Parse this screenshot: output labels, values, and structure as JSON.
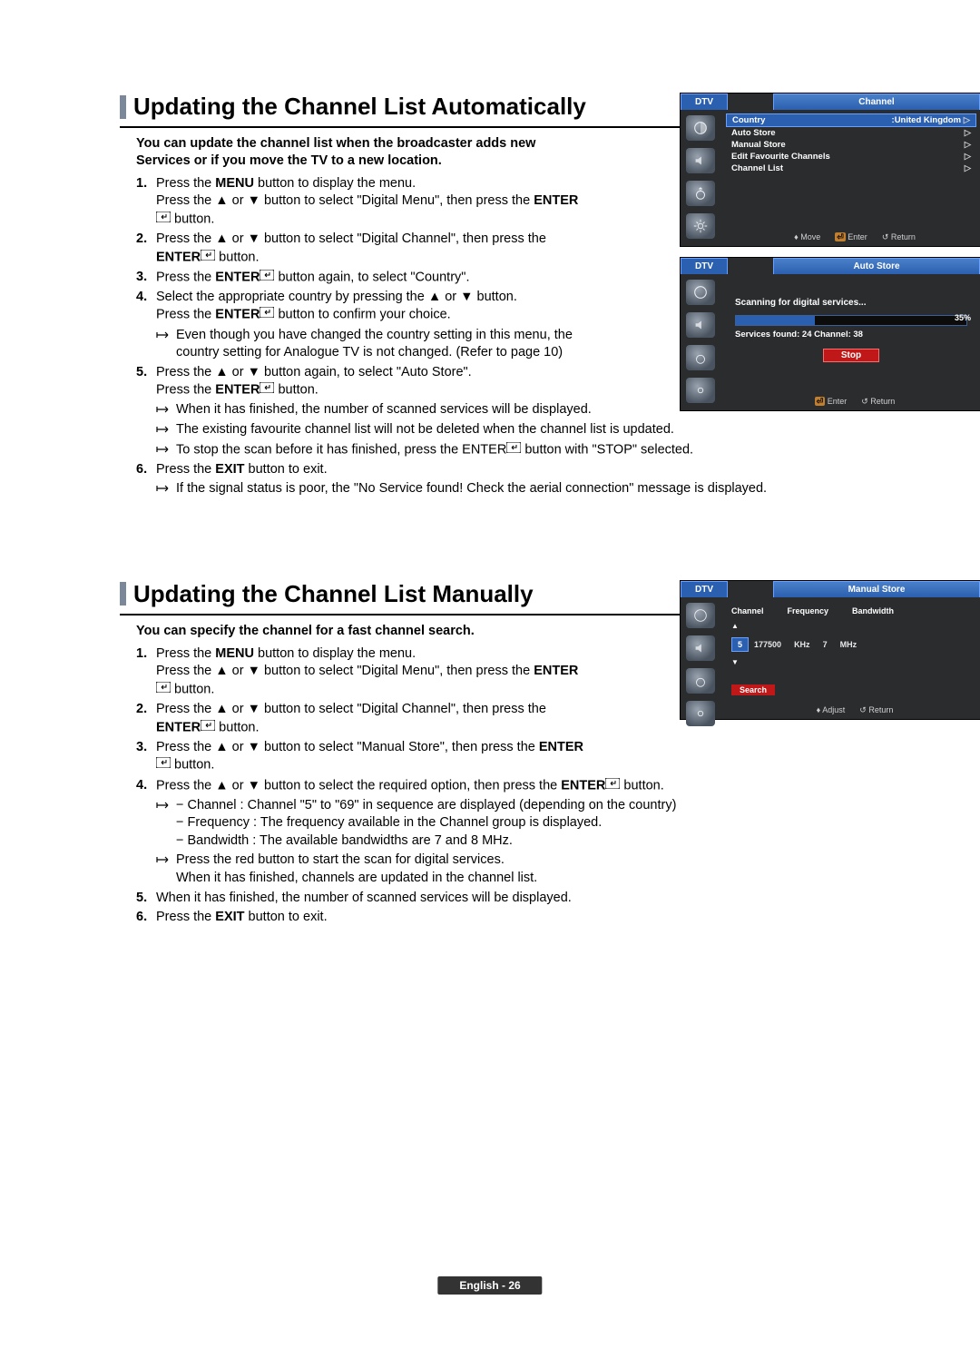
{
  "section1": {
    "heading": "Updating the Channel List Automatically",
    "intro": "You can update the channel list when the broadcaster adds new Services or if you move the TV to a new location.",
    "steps": [
      {
        "n": "1.",
        "lead": "Press the ",
        "bold1": "MENU",
        "mid": " button to display the menu.\nPress the ▲ or ▼ button to select \"Digital Menu\", then press the ",
        "bold2": "ENTER",
        "tail": " button."
      },
      {
        "n": "2.",
        "lead": "Press the ▲ or ▼ button to select \"Digital Channel\", then press the ",
        "bold2": "ENTER",
        "tail": " button."
      },
      {
        "n": "3.",
        "lead": "Press the ",
        "bold2": "ENTER",
        "tail": " button again, to select \"Country\"."
      },
      {
        "n": "4.",
        "lead": "Select the appropriate country by pressing the ▲ or ▼ button.\nPress the ",
        "bold2": "ENTER",
        "tail": " button to confirm your choice.",
        "sub": [
          "Even though you have changed the country setting in this menu, the country setting for Analogue TV is not changed. (Refer to page 10)"
        ]
      },
      {
        "n": "5.",
        "lead": "Press the ▲ or ▼ button again, to select \"Auto Store\".\nPress the ",
        "bold2": "ENTER",
        "tail": " button.",
        "sub": [
          "When it has finished, the number of scanned services will be displayed.",
          "The existing favourite channel list will not be deleted when the channel list is updated.",
          "To stop the scan before it has finished, press the ENTER button with \"STOP\" selected."
        ]
      },
      {
        "n": "6.",
        "lead": "Press the ",
        "bold1": "EXIT",
        "tail": " button to exit.",
        "sub": [
          "If the signal status is poor, the \"No Service found! Check the aerial connection\" message is displayed."
        ]
      }
    ]
  },
  "osd1": {
    "dtv": "DTV",
    "title": "Channel",
    "rows": [
      {
        "label": "Country",
        "value": ":United Kingdom",
        "tri": "▷",
        "hl": true
      },
      {
        "label": "Auto Store",
        "value": "",
        "tri": "▷"
      },
      {
        "label": "Manual Store",
        "value": "",
        "tri": "▷"
      },
      {
        "label": "Edit Favourite Channels",
        "value": "",
        "tri": "▷"
      },
      {
        "label": "Channel List",
        "value": "",
        "tri": "▷"
      }
    ],
    "footer": {
      "move": "Move",
      "enter": "Enter",
      "return": "Return"
    }
  },
  "osd2": {
    "dtv": "DTV",
    "title": "Auto Store",
    "scanning": "Scanning for digital services...",
    "pct": "35%",
    "found": "Services found: 24    Channel: 38",
    "stop": "Stop",
    "footer": {
      "enter": "Enter",
      "return": "Return"
    }
  },
  "section2": {
    "heading": "Updating the Channel List Manually",
    "intro": "You can specify the channel for a fast channel search.",
    "steps": [
      {
        "n": "1.",
        "lead": "Press the ",
        "bold1": "MENU",
        "mid": " button to display the menu.\nPress the ▲ or ▼ button to select \"Digital Menu\", then press the ",
        "bold2": "ENTER",
        "tail": " button."
      },
      {
        "n": "2.",
        "lead": "Press the ▲ or ▼ button to select \"Digital Channel\", then press the ",
        "bold2": "ENTER",
        "tail": " button."
      },
      {
        "n": "3.",
        "lead": "Press the ▲ or ▼ button to select \"Manual Store\", then press the ",
        "bold2": "ENTER",
        "tail": " button."
      },
      {
        "n": "4.",
        "lead": "Press the ▲ or ▼ button to select  the required option,  then press the ",
        "bold2": "ENTER",
        "tail": " button.",
        "sub_opts": {
          "channel_label": "− Channel",
          "channel_text": " : Channel \"5\" to \"69\" in sequence are displayed (depending on the country)",
          "freq_label": "− Frequency",
          "freq_text": " : The frequency available in the Channel group is displayed.",
          "bw_label": "− Bandwidth",
          "bw_text": " : The available bandwidths are 7 and 8 MHz."
        },
        "sub2": "Press the red button to start the scan for digital services.\nWhen it has finished, channels are updated in the channel list."
      },
      {
        "n": "5.",
        "lead": "When it has finished, the number of scanned services will be displayed."
      },
      {
        "n": "6.",
        "lead": "Press the ",
        "bold1": "EXIT",
        "tail": " button to exit."
      }
    ]
  },
  "osd3": {
    "dtv": "DTV",
    "title": "Manual Store",
    "cols": {
      "c1": "Channel",
      "c2": "Frequency",
      "c3": "Bandwidth"
    },
    "vals": {
      "ch": "5",
      "freq": "177500",
      "khz": "KHz",
      "bw": "7",
      "mhz": "MHz"
    },
    "search": "Search",
    "footer": {
      "adjust": "Adjust",
      "return": "Return"
    }
  },
  "footer": "English - 26"
}
